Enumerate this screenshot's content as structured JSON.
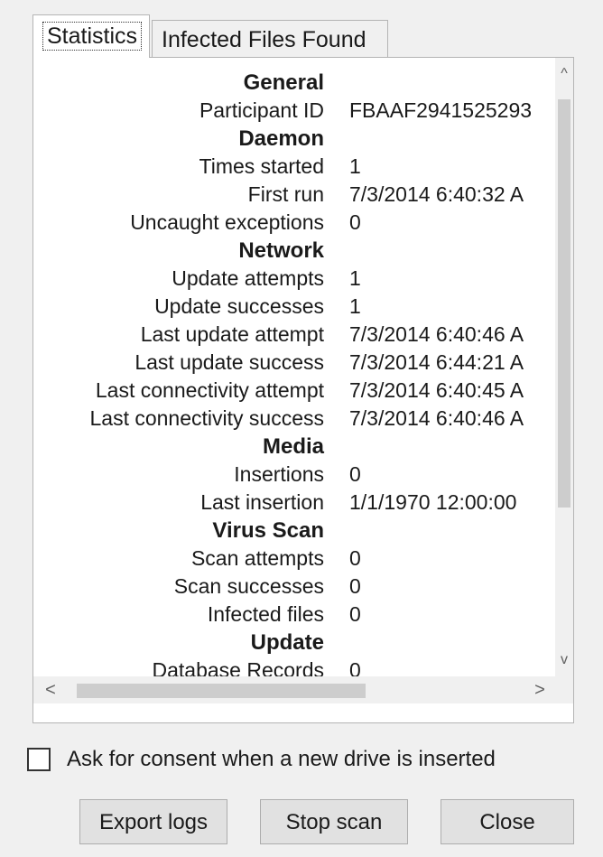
{
  "tabs": {
    "statistics": "Statistics",
    "infected": "Infected Files Found"
  },
  "stats": [
    {
      "type": "header",
      "key": "General"
    },
    {
      "type": "row",
      "key": "Participant ID",
      "value": "FBAAF2941525293"
    },
    {
      "type": "header",
      "key": "Daemon"
    },
    {
      "type": "row",
      "key": "Times started",
      "value": "1"
    },
    {
      "type": "row",
      "key": "First run",
      "value": "7/3/2014 6:40:32 A"
    },
    {
      "type": "row",
      "key": "Uncaught exceptions",
      "value": "0"
    },
    {
      "type": "header",
      "key": "Network"
    },
    {
      "type": "row",
      "key": "Update attempts",
      "value": "1"
    },
    {
      "type": "row",
      "key": "Update successes",
      "value": "1"
    },
    {
      "type": "row",
      "key": "Last update attempt",
      "value": "7/3/2014 6:40:46 A"
    },
    {
      "type": "row",
      "key": "Last update success",
      "value": "7/3/2014 6:44:21 A"
    },
    {
      "type": "row",
      "key": "Last connectivity attempt",
      "value": "7/3/2014 6:40:45 A"
    },
    {
      "type": "row",
      "key": "Last connectivity success",
      "value": "7/3/2014 6:40:46 A"
    },
    {
      "type": "header",
      "key": "Media"
    },
    {
      "type": "row",
      "key": "Insertions",
      "value": "0"
    },
    {
      "type": "row",
      "key": "Last insertion",
      "value": "1/1/1970 12:00:00"
    },
    {
      "type": "header",
      "key": "Virus Scan"
    },
    {
      "type": "row",
      "key": "Scan attempts",
      "value": "0"
    },
    {
      "type": "row",
      "key": "Scan successes",
      "value": "0"
    },
    {
      "type": "row",
      "key": "Infected files",
      "value": "0"
    },
    {
      "type": "header",
      "key": "Update"
    },
    {
      "type": "row",
      "key": "Database Records",
      "value": "0"
    }
  ],
  "scroll": {
    "up": "^",
    "down": "v",
    "left": "<",
    "right": ">"
  },
  "consent": {
    "label": "Ask for consent when a new drive is inserted",
    "checked": false
  },
  "buttons": {
    "export": "Export logs",
    "stop": "Stop scan",
    "close": "Close"
  }
}
